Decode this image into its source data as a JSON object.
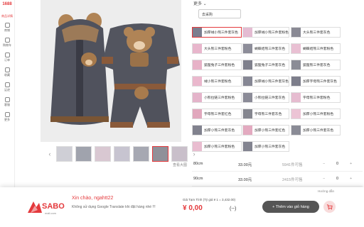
{
  "rail": {
    "logo": "1688",
    "home": "商品详情",
    "items": [
      "商铺",
      "购物车",
      "订单",
      "收藏",
      "足迹",
      "客服",
      "更多"
    ]
  },
  "gallery": {
    "prev": "‹",
    "next": "›",
    "thumb_count": 7,
    "link": "查看大图"
  },
  "panel": {
    "more": "更多 ⌄",
    "dropdown": "去采购"
  },
  "chips": [
    {
      "label": "加厚绒小熊三件套灰色",
      "col": 0,
      "row": 0,
      "sel": true,
      "color": "#7b7e8f"
    },
    {
      "label": "加厚绒小熊三件套粉色",
      "col": 1,
      "row": 0,
      "sel": false,
      "color": "#e4bcd2"
    },
    {
      "label": "大头熊三件套灰色",
      "col": 2,
      "row": 0,
      "sel": false,
      "color": "#8a8a95"
    },
    {
      "label": "大头熊三件套粉色",
      "col": 0,
      "row": 1,
      "sel": false,
      "color": "#e8b6cc"
    },
    {
      "label": "蝴蝶结熊三件套灰色",
      "col": 1,
      "row": 1,
      "sel": false,
      "color": "#8d8d99"
    },
    {
      "label": "蝴蝶结熊三件套粉色",
      "col": 2,
      "row": 1,
      "sel": false,
      "color": "#e9c0d3"
    },
    {
      "label": "狐狸兔子三件套粉色",
      "col": 0,
      "row": 2,
      "sel": false,
      "color": "#e7b2c7"
    },
    {
      "label": "狐狸兔子三件套灰色",
      "col": 1,
      "row": 2,
      "sel": false,
      "color": "#7f808c"
    },
    {
      "label": "狐狸熊三件套灰色",
      "col": 2,
      "row": 2,
      "sel": false,
      "color": "#8b8c96"
    },
    {
      "label": "绒小熊三件套粉色",
      "col": 0,
      "row": 3,
      "sel": false,
      "color": "#eab8cd"
    },
    {
      "label": "加厚绒小熊三件套灰色",
      "col": 1,
      "row": 3,
      "sel": false,
      "color": "#868794"
    },
    {
      "label": "加厚字母熊三件套灰色",
      "col": 2,
      "row": 3,
      "sel": false,
      "color": "#7d7e8b"
    },
    {
      "label": "小熊拉链三件套粉色",
      "col": 0,
      "row": 4,
      "sel": false,
      "color": "#e4b4ca"
    },
    {
      "label": "小熊拉链三件套灰色",
      "col": 1,
      "row": 4,
      "sel": false,
      "color": "#8b8b97"
    },
    {
      "label": "字母熊三件套粉色",
      "col": 2,
      "row": 4,
      "sel": false,
      "color": "#e6bcd0"
    },
    {
      "label": "字母熊三件套红色",
      "col": 0,
      "row": 5,
      "sel": false,
      "color": "#e1a8bd"
    },
    {
      "label": "字母熊三件套灰色",
      "col": 1,
      "row": 5,
      "sel": false,
      "color": "#85868f"
    },
    {
      "label": "加厚小熊三件套粉色",
      "col": 2,
      "row": 5,
      "sel": false,
      "color": "#ecc4d5"
    },
    {
      "label": "加厚小熊三件套灰色",
      "col": 0,
      "row": 6,
      "sel": false,
      "color": "#81828e"
    },
    {
      "label": "加厚小熊三件套红色",
      "col": 1,
      "row": 6,
      "sel": false,
      "color": "#e3aac0"
    },
    {
      "label": "加厚小熊三件套灰色",
      "col": 2,
      "row": 6,
      "sel": false,
      "color": "#8a8b96"
    },
    {
      "label": "加厚小熊三件套粉色",
      "col": 0,
      "row": 7,
      "sel": false,
      "color": "#e9bdd0"
    },
    {
      "label": "加厚小熊三件套灰色",
      "col": 1,
      "row": 7,
      "sel": false,
      "color": "#838490"
    }
  ],
  "rows": [
    {
      "size": "80cm",
      "price": "33.00元",
      "stock": "5941件可售",
      "minus": "−",
      "qty": "0",
      "plus": "+"
    },
    {
      "size": "90cm",
      "price": "33.00元",
      "stock": "2415件可售",
      "minus": "−",
      "qty": "0",
      "plus": "+"
    }
  ],
  "sabo": {
    "greeting": "Xin chào, ngahtt22",
    "note": "Không sử dụng Google Translate khi đặt hàng nhé !!!",
    "temp_label": "Giá Tạm Tính (Tỷ giá ¥ 1 = 3,432.00)",
    "total": "¥ 0,00",
    "close": "(--)",
    "hint": "Hướng dẫn",
    "add_button": "+ Thêm vào giỏ hàng",
    "brand": "SABO",
    "brand_sub": "mall.com",
    "brand_color": "#e4393c"
  }
}
